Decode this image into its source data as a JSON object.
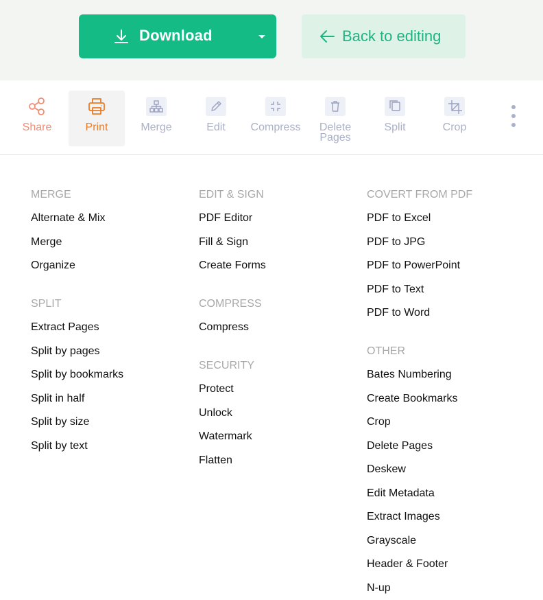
{
  "topbar": {
    "download_label": "Download",
    "back_label": "Back to editing",
    "download_color": "#15bb85",
    "back_color": "#1db482"
  },
  "toolbar": {
    "tools": [
      {
        "label": "Share",
        "icon": "share-icon"
      },
      {
        "label": "Print",
        "icon": "print-icon"
      },
      {
        "label": "Merge",
        "icon": "sitemap-icon"
      },
      {
        "label": "Edit",
        "icon": "pencil-icon"
      },
      {
        "label": "Compress",
        "icon": "compress-icon"
      },
      {
        "label": "Delete Pages",
        "icon": "trash-icon"
      },
      {
        "label": "Split",
        "icon": "copy-icon"
      },
      {
        "label": "Crop",
        "icon": "crop-icon"
      }
    ],
    "more_icon": "kebab-menu-icon"
  },
  "menu": {
    "merge": {
      "heading": "MERGE",
      "items": [
        "Alternate & Mix",
        "Merge",
        "Organize"
      ]
    },
    "split": {
      "heading": "SPLIT",
      "items": [
        "Extract Pages",
        "Split by pages",
        "Split by bookmarks",
        "Split in half",
        "Split by size",
        "Split by text"
      ]
    },
    "edit_sign": {
      "heading": "EDIT & SIGN",
      "items": [
        "PDF Editor",
        "Fill & Sign",
        "Create Forms"
      ]
    },
    "compress": {
      "heading": "COMPRESS",
      "items": [
        "Compress"
      ]
    },
    "security": {
      "heading": "SECURITY",
      "items": [
        "Protect",
        "Unlock",
        "Watermark",
        "Flatten"
      ]
    },
    "convert": {
      "heading": "COVERT FROM PDF",
      "items": [
        "PDF to Excel",
        "PDF to JPG",
        "PDF to PowerPoint",
        "PDF to Text",
        "PDF to Word"
      ]
    },
    "other": {
      "heading": "OTHER",
      "items": [
        "Bates Numbering",
        "Create Bookmarks",
        "Crop",
        "Delete Pages",
        "Deskew",
        "Edit Metadata",
        "Extract Images",
        "Grayscale",
        "Header & Footer",
        "N-up"
      ]
    }
  }
}
